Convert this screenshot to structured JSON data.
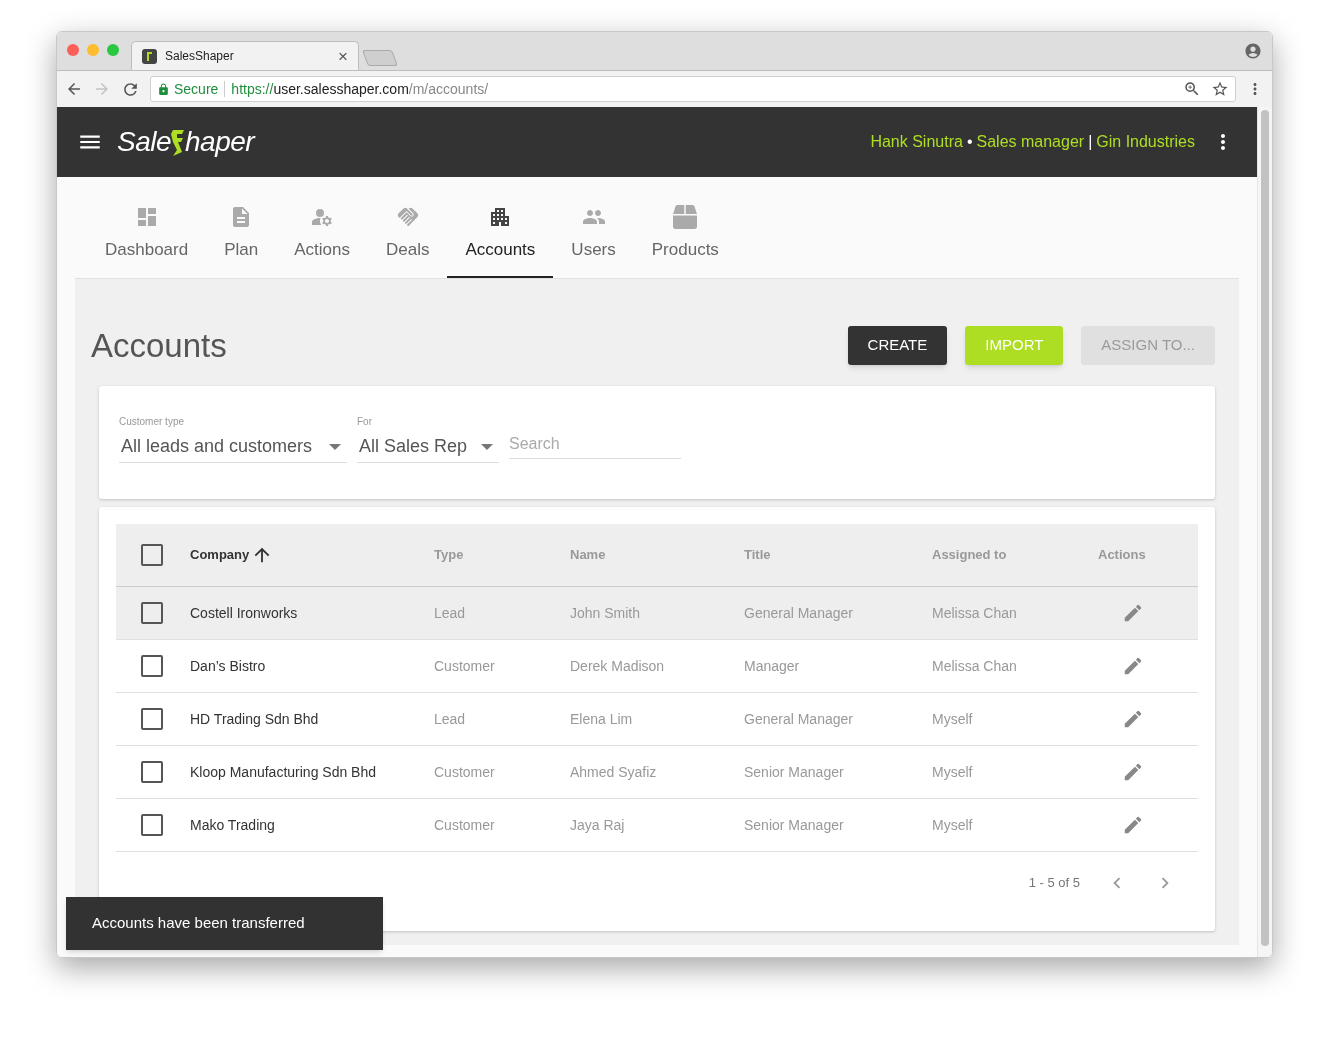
{
  "browser": {
    "tab_title": "SalesShaper",
    "close": "×",
    "secure": "Secure",
    "url_scheme": "https://",
    "url_host": "user.salesshaper.com",
    "url_path": "/m/accounts/"
  },
  "header": {
    "logo_before": "Sale",
    "logo_after": "haper",
    "user": "Hank Sinutra",
    "separator": "•",
    "role": "Sales manager",
    "divider": "|",
    "company": "Gin Industries"
  },
  "nav": [
    {
      "label": "Dashboard",
      "selected": false
    },
    {
      "label": "Plan",
      "selected": false
    },
    {
      "label": "Actions",
      "selected": false
    },
    {
      "label": "Deals",
      "selected": false
    },
    {
      "label": "Accounts",
      "selected": true
    },
    {
      "label": "Users",
      "selected": false
    },
    {
      "label": "Products",
      "selected": false
    }
  ],
  "page_title": "Accounts",
  "buttons": [
    {
      "label": "CREATE",
      "kind": "dark",
      "disabled": false
    },
    {
      "label": "IMPORT",
      "kind": "accent",
      "disabled": false
    },
    {
      "label": "ASSIGN TO...",
      "kind": "plain",
      "disabled": true
    }
  ],
  "filters": {
    "customer_type": {
      "label": "Customer type",
      "value": "All leads and customers"
    },
    "for": {
      "label": "For",
      "value": "All Sales Rep"
    },
    "search": {
      "placeholder": "Search"
    }
  },
  "table": {
    "header_checked": false,
    "columns": [
      {
        "label": "Company",
        "sorted": true
      },
      {
        "label": "Type",
        "sorted": false
      },
      {
        "label": "Name",
        "sorted": false
      },
      {
        "label": "Title",
        "sorted": false
      },
      {
        "label": "Assigned to",
        "sorted": false
      },
      {
        "label": "Actions",
        "sorted": false
      }
    ],
    "rows": [
      {
        "company": "Costell Ironworks",
        "type": "Lead",
        "name": "John Smith",
        "title": "General Manager",
        "assigned": "Melissa Chan",
        "checked": false,
        "highlighted": true
      },
      {
        "company": "Dan’s Bistro",
        "type": "Customer",
        "name": "Derek Madison",
        "title": "Manager",
        "assigned": "Melissa Chan",
        "checked": false,
        "highlighted": false
      },
      {
        "company": "HD Trading Sdn Bhd",
        "type": "Lead",
        "name": "Elena Lim",
        "title": "General Manager",
        "assigned": "Myself",
        "checked": false,
        "highlighted": false
      },
      {
        "company": "Kloop Manufacturing Sdn Bhd",
        "type": "Customer",
        "name": "Ahmed Syafiz",
        "title": "Senior Manager",
        "assigned": "Myself",
        "checked": false,
        "highlighted": false
      },
      {
        "company": "Mako Trading",
        "type": "Customer",
        "name": "Jaya Raj",
        "title": "Senior Manager",
        "assigned": "Myself",
        "checked": false,
        "highlighted": false
      }
    ],
    "pagination": "1 - 5 of 5"
  },
  "snackbar": "Accounts have been transferred"
}
